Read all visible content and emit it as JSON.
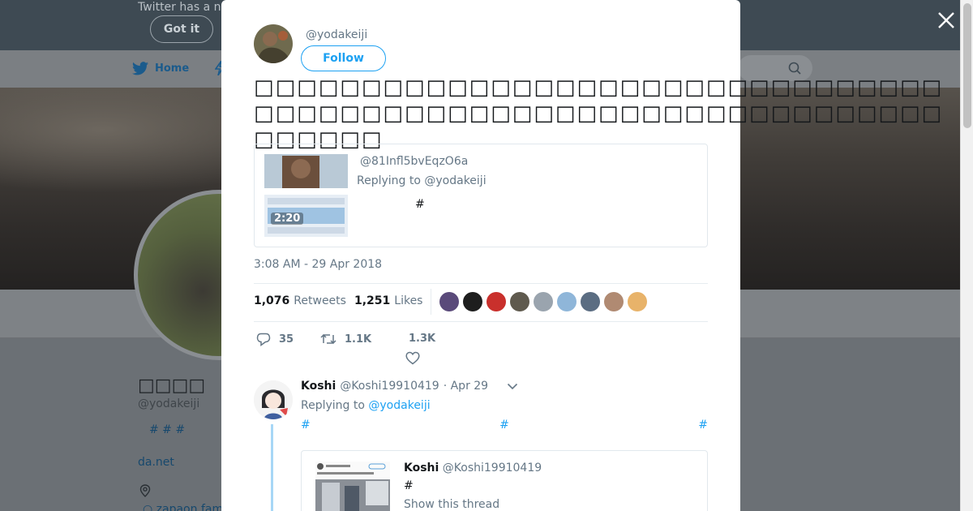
{
  "background": {
    "notice_text": "Twitter has a n",
    "notice_button": "Got it",
    "nav_home": "Home",
    "profile_name": "□□□□",
    "profile_handle": "@yodakeiji",
    "profile_tags": "# #        #",
    "profile_link": "da.net",
    "profile_location": "○ zapaon fam"
  },
  "tweet": {
    "author_handle": "@yodakeiji",
    "follow_label": "Follow",
    "text": "□□□□□□□□□□□□□□□□□□□□□□□□□□□□□□□□□□□□□□□□□□□□□□□□□□□□□□□□□□□□□□□□□□□□□□",
    "quoted": {
      "handle": "@81Infl5bvEqzO6a",
      "replying_to": "Replying to @yodakeiji",
      "text": "#",
      "video_duration": "2:20"
    },
    "timestamp": "3:08 AM - 29 Apr 2018",
    "retweets_count": "1,076",
    "retweets_label": "Retweets",
    "likes_count": "1,251",
    "likes_label": "Likes",
    "likers_colors": [
      "#5a4a7a",
      "#1e1e1e",
      "#c9302c",
      "#5f5a4e",
      "#9aa4ae",
      "#8fb6d9",
      "#5b6d82",
      "#b08a72",
      "#e8b36a"
    ],
    "actions": {
      "replies": "35",
      "retweets": "1.1K",
      "likes": "1.3K"
    }
  },
  "reply": {
    "name": "Koshi",
    "handle": "@Koshi19910419",
    "date": "· Apr 29",
    "replying_prefix": "Replying to ",
    "replying_to": "@yodakeiji",
    "hashtags": [
      "#",
      "#",
      "#"
    ],
    "card": {
      "name": "Koshi",
      "handle": "@Koshi19910419",
      "text": "#",
      "show_thread": "Show this thread"
    }
  },
  "colors": {
    "accent": "#1da1f2",
    "text_primary": "#14171a",
    "text_secondary": "#657786"
  }
}
